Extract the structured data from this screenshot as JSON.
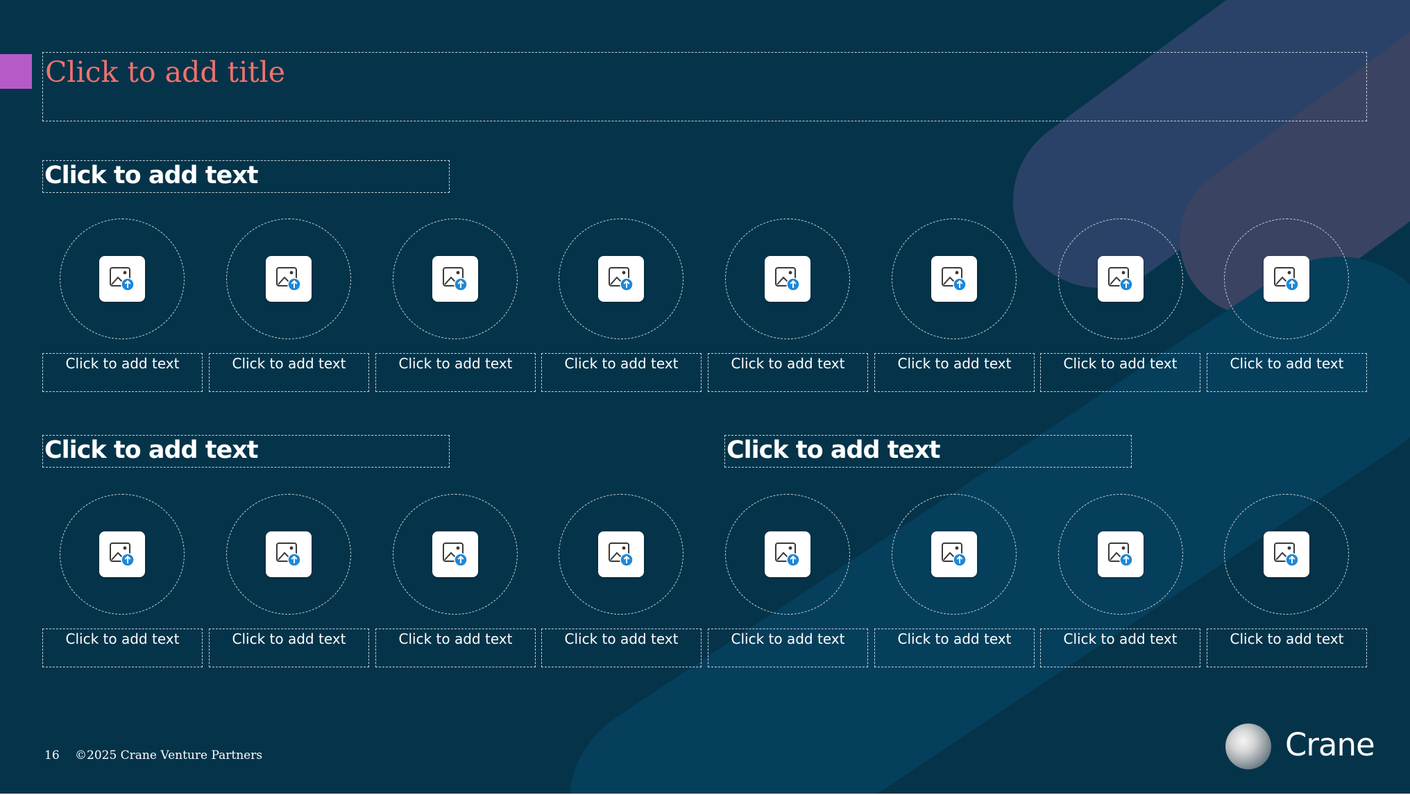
{
  "slide": {
    "title_placeholder": "Click to add title",
    "section_headers": [
      "Click to add text",
      "Click to add text",
      "Click to add text"
    ],
    "picture_placeholder_icon": "image-upload-icon",
    "row1_captions": [
      "Click to add text",
      "Click to add text",
      "Click to add text",
      "Click to add text",
      "Click to add text",
      "Click to add text",
      "Click to add text",
      "Click to add text"
    ],
    "row2_captions": [
      "Click to add text",
      "Click to add text",
      "Click to add text",
      "Click to add text",
      "Click to add text",
      "Click to add text",
      "Click to add text",
      "Click to add text"
    ]
  },
  "footer": {
    "page_number": "16",
    "copyright": "©2025 Crane Venture Partners"
  },
  "logo": {
    "text": "Crane"
  },
  "colors": {
    "background": "#05344a",
    "title": "#f2716d",
    "accent_bar": "#b65ac8",
    "text": "#ffffff",
    "icon_arrow": "#1e88d8"
  }
}
